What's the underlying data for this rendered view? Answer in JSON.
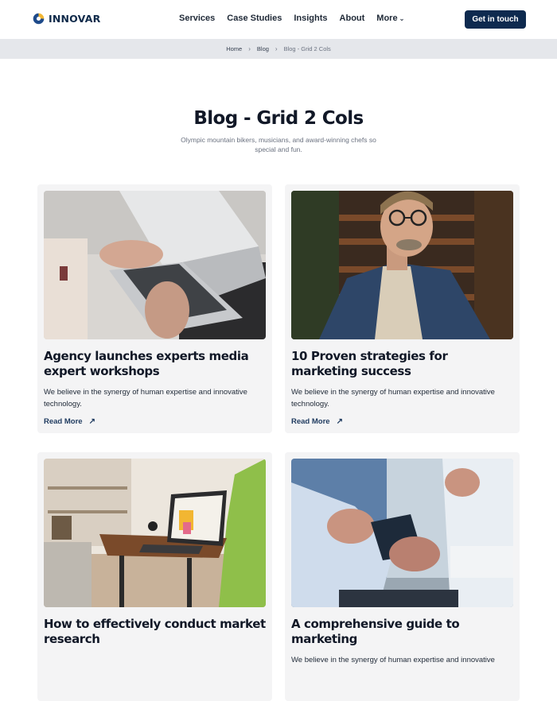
{
  "brand": {
    "name": "INNOVAR"
  },
  "nav": {
    "items": [
      "Services",
      "Case Studies",
      "Insights",
      "About"
    ],
    "more_label": "More",
    "cta_label": "Get in touch"
  },
  "breadcrumb": {
    "home": "Home",
    "blog": "Blog",
    "current": "Blog - Grid 2 Cols"
  },
  "hero": {
    "title": "Blog - Grid 2 Cols",
    "subtitle": "Olympic mountain bikers, musicians, and award-winning chefs so special and fun."
  },
  "posts": [
    {
      "title": "Agency launches experts media expert workshops",
      "excerpt": "We believe in the synergy of human expertise and innovative technology.",
      "link": "Read More",
      "image": "laptop-typing-photo"
    },
    {
      "title": "10 Proven strategies for marketing success",
      "excerpt": "We believe in the synergy of human expertise and innovative technology.",
      "link": "Read More",
      "image": "man-glasses-portrait-photo"
    },
    {
      "title": "How to effectively conduct market research",
      "excerpt": "",
      "link": "",
      "image": "tablet-on-table-photo"
    },
    {
      "title": "A comprehensive guide to marketing",
      "excerpt": "We believe in the synergy of human expertise and innovative",
      "link": "",
      "image": "phone-handshake-photo"
    }
  ],
  "colors": {
    "primary": "#0e2a4f",
    "breadcrumb_bg": "#e5e7eb",
    "card_bg": "#f4f4f5"
  }
}
